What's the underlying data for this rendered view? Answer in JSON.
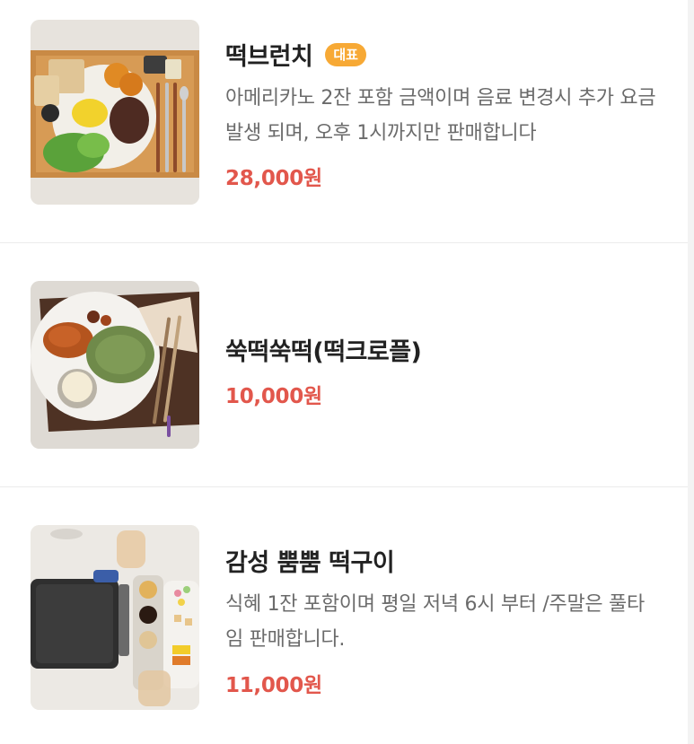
{
  "menu": {
    "items": [
      {
        "title": "떡브런치",
        "badge": "대표",
        "description": "아메리카노 2잔 포함 금액이며 음료 변경시 추가 요금 발생 되며, 오후 1시까지만 판매합니다",
        "price": "28,000원",
        "image": "brunch-plate-photo"
      },
      {
        "title": "쑥떡쑥떡(떡크로플)",
        "price": "10,000원",
        "image": "rice-cake-croffle-photo"
      },
      {
        "title": "감성 뿜뿜 떡구이",
        "description": "식혜 1잔 포함이며 평일 저녁 6시 부터 /주말은 풀타임 판매합니다.",
        "price": "11,000원",
        "image": "grilled-rice-cake-set-photo"
      }
    ]
  },
  "colors": {
    "price": "#e2574c",
    "badge": "#f7a935",
    "title": "#222222",
    "description": "#6b6b6b"
  }
}
